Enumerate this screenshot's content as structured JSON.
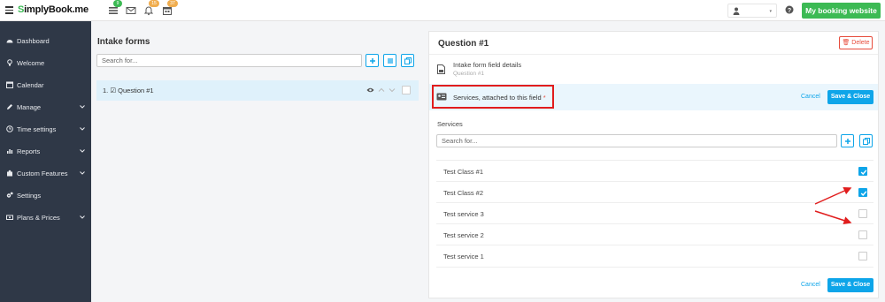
{
  "topbar": {
    "logo": "SimplyBook.me",
    "icons": [
      {
        "name": "list-icon",
        "badge": "9"
      },
      {
        "name": "envelope-icon",
        "badge": ""
      },
      {
        "name": "bell-icon",
        "badge": "15"
      },
      {
        "name": "calendar-icon",
        "badge": "37"
      }
    ],
    "booking_button": "My booking website"
  },
  "sidebar": {
    "items": [
      {
        "label": "Dashboard",
        "icon": "dashboard-icon",
        "chevron": false
      },
      {
        "label": "Welcome",
        "icon": "bulb-icon",
        "chevron": false
      },
      {
        "label": "Calendar",
        "icon": "calendar-icon",
        "chevron": false
      },
      {
        "label": "Manage",
        "icon": "pencil-icon",
        "chevron": true
      },
      {
        "label": "Time settings",
        "icon": "clock-icon",
        "chevron": true
      },
      {
        "label": "Reports",
        "icon": "bar-chart-icon",
        "chevron": true
      },
      {
        "label": "Custom Features",
        "icon": "puzzle-icon",
        "chevron": true
      },
      {
        "label": "Settings",
        "icon": "gears-icon",
        "chevron": false
      },
      {
        "label": "Plans & Prices",
        "icon": "money-icon",
        "chevron": true
      }
    ]
  },
  "intake": {
    "title": "Intake forms",
    "search_placeholder": "Search for...",
    "question_label": "1. ☑ Question #1"
  },
  "detail": {
    "title": "Question #1",
    "delete_label": "🗑 Delete",
    "field_details_title": "Intake form field details",
    "field_details_sub": "Question #1",
    "services_attached_label": "Services, attached to this field",
    "required_mark": "*",
    "cancel_label": "Cancel",
    "save_label": "Save & Close",
    "services_label": "Services",
    "services_search_placeholder": "Search for...",
    "services": [
      {
        "name": "Test Class #1",
        "checked": true
      },
      {
        "name": "Test Class #2",
        "checked": true
      },
      {
        "name": "Test service 3",
        "checked": false
      },
      {
        "name": "Test service 2",
        "checked": false
      },
      {
        "name": "Test service 1",
        "checked": false
      }
    ]
  },
  "colors": {
    "brand_green": "#3cba54",
    "accent_blue": "#0ea5e9",
    "sidebar_bg": "#2f3847",
    "highlight_red": "#e11d1d"
  }
}
